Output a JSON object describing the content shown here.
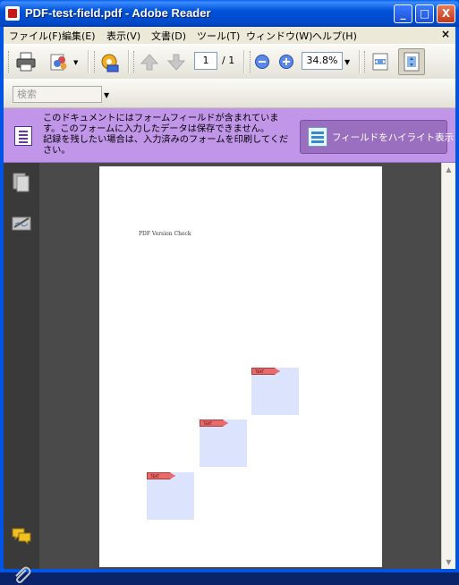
{
  "window": {
    "title": "PDF-test-field.pdf - Adobe Reader",
    "minimize_glyph": "_",
    "maximize_glyph": "□",
    "close_glyph": "X"
  },
  "menubar": {
    "items": [
      "ファイル(F)",
      "編集(E)",
      "表示(V)",
      "文書(D)",
      "ツール(T)",
      "ウィンドウ(W)",
      "ヘルプ(H)"
    ],
    "close_glyph": "×"
  },
  "toolbar": {
    "page_current": "1",
    "page_total": "/ 1",
    "zoom": "34.8%",
    "dropdown_glyph": "▼"
  },
  "search": {
    "placeholder": "検索",
    "dropdown_glyph": "▼"
  },
  "notice": {
    "line1": "このドキュメントにはフォームフィールドが含まれています。このフォームに入力したデータは保存できません。",
    "line2": "記録を残したい場合は、入力済みのフォームを印刷してください。",
    "highlight_button": "フィールドをハイライト表示"
  },
  "document": {
    "page_title": "PDF Version Check",
    "field_tag": "TEXT FIELD"
  },
  "scrollbar": {
    "up_glyph": "▲",
    "down_glyph": "▼"
  },
  "colors": {
    "title_bar": "#0054e3",
    "notice_bg": "#c196e8",
    "field_fill": "#dce3fd",
    "field_tag": "#e86a6a"
  }
}
